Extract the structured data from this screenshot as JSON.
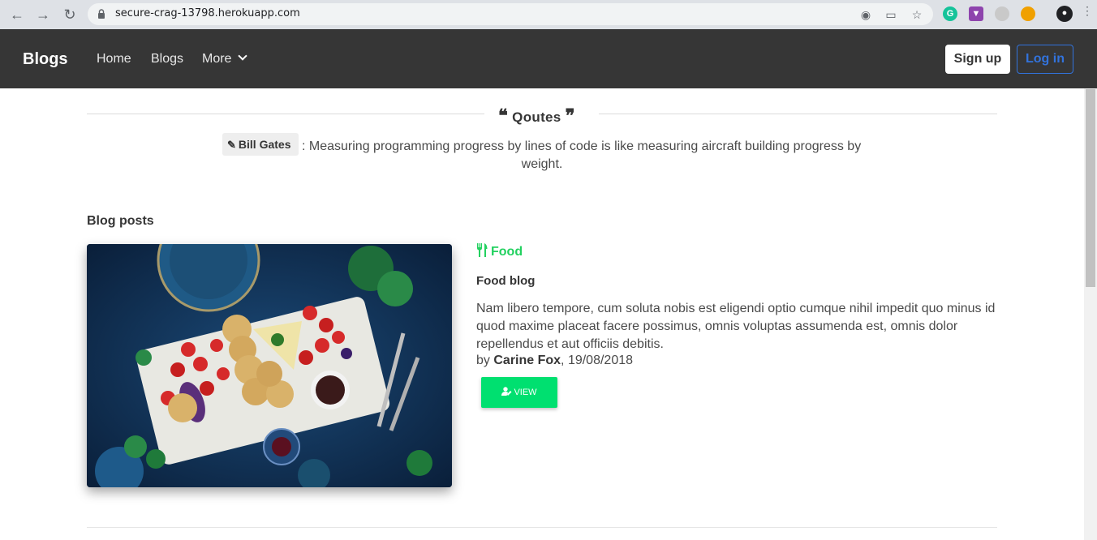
{
  "browser": {
    "url": "secure-crag-13798.herokuapp.com"
  },
  "navbar": {
    "brand": "Blogs",
    "links": [
      "Home",
      "Blogs",
      "More"
    ],
    "signup_label": "Sign up",
    "login_label": "Log in"
  },
  "quotes": {
    "title": "Qoutes",
    "author": "Bill Gates",
    "text_line1": ": Measuring programming progress by lines of code is like measuring aircraft building progress by",
    "text_line2": "weight."
  },
  "blog": {
    "section_title": "Blog posts",
    "posts": [
      {
        "category": "Food",
        "title": "Food blog",
        "body": "Nam libero tempore, cum soluta nobis est eligendi optio cumque nihil impedit quo minus id quod maxime placeat facere possimus, omnis voluptas assumenda est, omnis dolor repellendus et aut officiis debitis.",
        "by_label": "by",
        "author": "Carine Fox",
        "date": ", 19/08/2018",
        "view_label": "VIEW"
      }
    ]
  },
  "colors": {
    "navbar_bg": "#363636",
    "accent_green": "#23d160",
    "button_green": "#00e070",
    "login_blue": "#3273dc"
  }
}
